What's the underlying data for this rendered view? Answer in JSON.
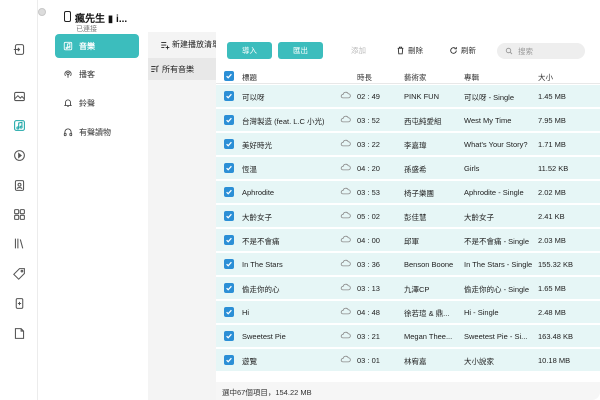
{
  "device": {
    "name": "瘋先生 ▮ i...",
    "status": "已連接"
  },
  "categories": [
    {
      "label": "音樂",
      "icon": "music-note-icon",
      "active": true
    },
    {
      "label": "播客",
      "icon": "podcast-icon",
      "active": false
    },
    {
      "label": "鈴聲",
      "icon": "bell-icon",
      "active": false
    },
    {
      "label": "有聲讀物",
      "icon": "audiobook-icon",
      "active": false
    }
  ],
  "playlists": {
    "new_label": "新建播放清單",
    "all_label": "所有音樂"
  },
  "toolbar": {
    "import_label": "導入",
    "export_label": "匯出",
    "add_label": "添加",
    "delete_label": "刪除",
    "refresh_label": "刷新",
    "search_placeholder": "搜索"
  },
  "table": {
    "columns": [
      "標題",
      "時長",
      "藝術家",
      "專輯",
      "大小"
    ],
    "rows": [
      {
        "title": "可以呀",
        "duration": "02 : 49",
        "artist": "PINK FUN",
        "album": "可以呀 - Single",
        "size": "1.45 MB"
      },
      {
        "title": "台灣製造 (feat. L.C 小光)",
        "duration": "03 : 52",
        "artist": "西屯純愛組",
        "album": "West My Time",
        "size": "7.95 MB"
      },
      {
        "title": "美好時光",
        "duration": "03 : 22",
        "artist": "李嘉瑋",
        "album": "What's Your Story?",
        "size": "1.71 MB"
      },
      {
        "title": "恆溫",
        "duration": "04 : 20",
        "artist": "孫盛希",
        "album": "Girls",
        "size": "11.52 KB"
      },
      {
        "title": "Aphrodite",
        "duration": "03 : 53",
        "artist": "椅子樂團",
        "album": "Aphrodite - Single",
        "size": "2.02 MB"
      },
      {
        "title": "大齡女子",
        "duration": "05 : 02",
        "artist": "彭佳慧",
        "album": "大齡女子",
        "size": "2.41 KB"
      },
      {
        "title": "不是不會痛",
        "duration": "04 : 00",
        "artist": "邱軍",
        "album": "不是不會痛 - Single",
        "size": "2.03 MB"
      },
      {
        "title": "In The Stars",
        "duration": "03 : 36",
        "artist": "Benson Boone",
        "album": "In The Stars - Single",
        "size": "155.32 KB"
      },
      {
        "title": "偷走你的心",
        "duration": "03 : 13",
        "artist": "九澤CP",
        "album": "偷走你的心 - Single",
        "size": "1.65 MB"
      },
      {
        "title": "Hi",
        "duration": "04 : 48",
        "artist": "徐若瑄 & 鼎...",
        "album": "Hi - Single",
        "size": "2.48 MB"
      },
      {
        "title": "Sweetest Pie",
        "duration": "03 : 21",
        "artist": "Megan Thee...",
        "album": "Sweetest Pie - Si...",
        "size": "163.48 KB"
      },
      {
        "title": "遊覽",
        "duration": "03 : 01",
        "artist": "林宥嘉",
        "album": "大小說家",
        "size": "10.18 MB"
      }
    ]
  },
  "footer": {
    "summary": "選中67個項目，154.22 MB"
  },
  "colors": {
    "accent": "#3cbdbd",
    "checkbox": "#2b8fd6",
    "row_bg": "#e6f6f6"
  }
}
